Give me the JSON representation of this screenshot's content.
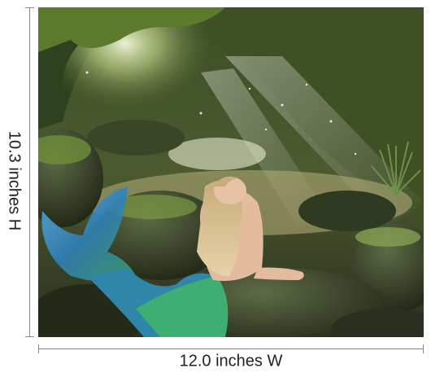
{
  "product": {
    "height_label": "10.3 inches H",
    "width_label": "12.0 inches W"
  },
  "colors": {
    "moss": "#6f8f3a",
    "cave_dark": "#2e3a1e",
    "light_glow": "#e8f0c8",
    "tail_blue": "#3d8fc9",
    "tail_green": "#3fa46a",
    "hair": "#d8c39a",
    "skin": "#e8c2a6"
  }
}
